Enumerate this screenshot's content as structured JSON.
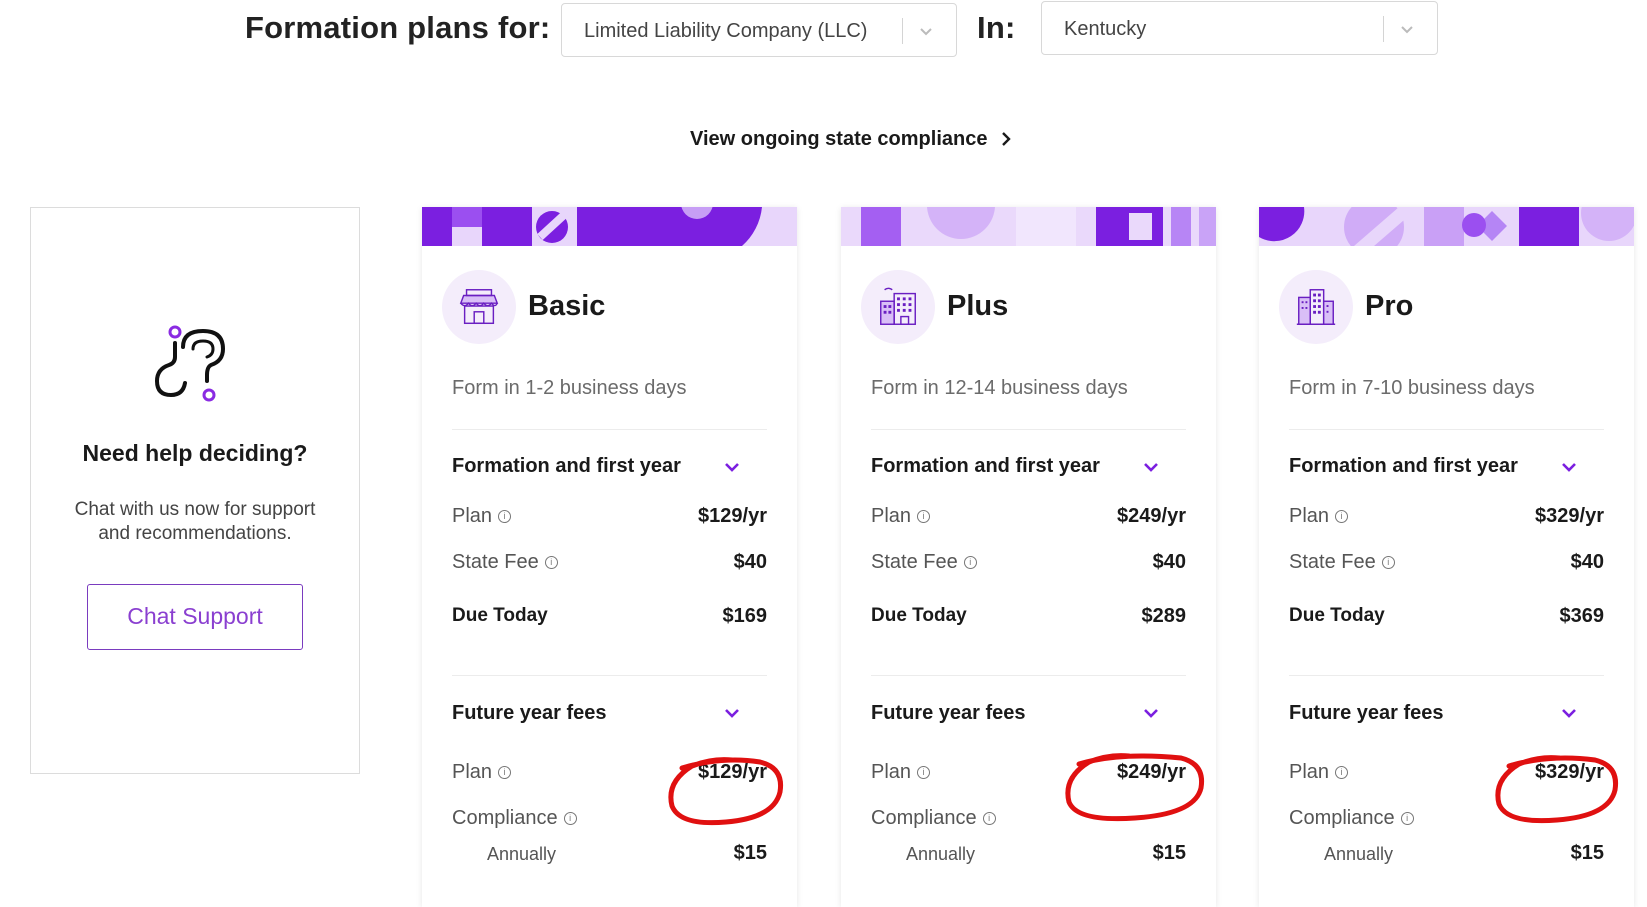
{
  "header": {
    "formation_label": "Formation plans for:",
    "entity_select": "Limited Liability Company (LLC)",
    "in_label": "In:",
    "state_select": "Kentucky",
    "view_link": "View ongoing state compliance"
  },
  "help": {
    "title": "Need help deciding?",
    "subtitle_line1": "Chat with us now for support",
    "subtitle_line2": "and recommendations.",
    "button": "Chat Support"
  },
  "colors": {
    "accent": "#7b1fe0",
    "accent_light": "#e5d2f9",
    "annotation": "#e01010"
  },
  "plans": [
    {
      "name": "Basic",
      "icon": "storefront-icon",
      "form_time": "Form in 1-2 business days",
      "first_year_title": "Formation and first year",
      "plan_label": "Plan",
      "plan_value": "$129/yr",
      "state_fee_label": "State Fee",
      "state_fee_value": "$40",
      "due_label": "Due Today",
      "due_value": "$169",
      "future_title": "Future year fees",
      "future_plan_label": "Plan",
      "future_plan_value": "$129/yr",
      "compliance_label": "Compliance",
      "annually_label": "Annually",
      "annually_value": "$15"
    },
    {
      "name": "Plus",
      "icon": "office-building-icon",
      "form_time": "Form in 12-14 business days",
      "first_year_title": "Formation and first year",
      "plan_label": "Plan",
      "plan_value": "$249/yr",
      "state_fee_label": "State Fee",
      "state_fee_value": "$40",
      "due_label": "Due Today",
      "due_value": "$289",
      "future_title": "Future year fees",
      "future_plan_label": "Plan",
      "future_plan_value": "$249/yr",
      "compliance_label": "Compliance",
      "annually_label": "Annually",
      "annually_value": "$15"
    },
    {
      "name": "Pro",
      "icon": "skyscraper-icon",
      "form_time": "Form in 7-10 business days",
      "first_year_title": "Formation and first year",
      "plan_label": "Plan",
      "plan_value": "$329/yr",
      "state_fee_label": "State Fee",
      "state_fee_value": "$40",
      "due_label": "Due Today",
      "due_value": "$369",
      "future_title": "Future year fees",
      "future_plan_label": "Plan",
      "future_plan_value": "$329/yr",
      "compliance_label": "Compliance",
      "annually_label": "Annually",
      "annually_value": "$15"
    }
  ]
}
